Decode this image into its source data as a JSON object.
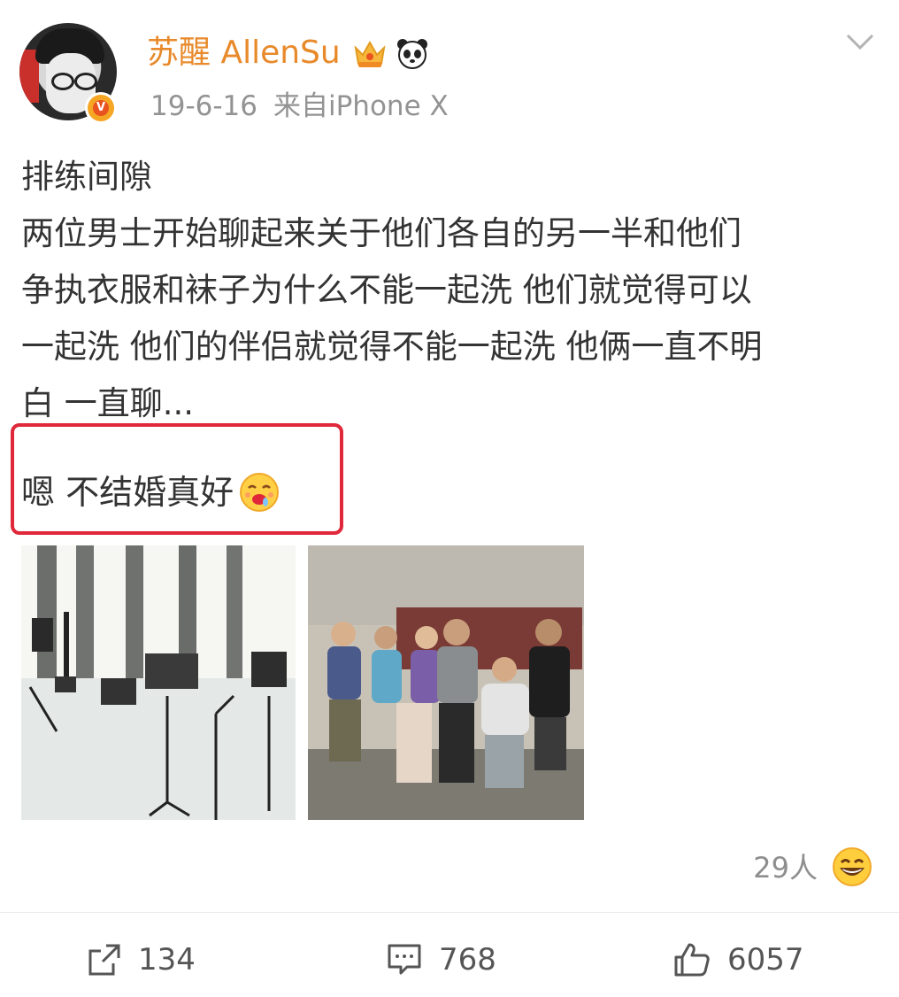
{
  "post": {
    "author": {
      "name": "苏醒 AllenSu",
      "badges": [
        "crown-icon",
        "panda-icon"
      ],
      "verified": true
    },
    "date": "19-6-16",
    "source": "来自iPhone X",
    "lines": [
      "排练间隙",
      "两位男士开始聊起来关于他们各自的另一半和他们",
      "争执衣服和袜子为什么不能一起洗 他们就觉得可以",
      "一起洗 他们的伴侣就觉得不能一起洗 他俩一直不明",
      "白 一直聊..."
    ],
    "highlighted_line": "嗯 不结婚真好",
    "highlight_color": "#e0283a",
    "photos": [
      "rehearsal-room-photo",
      "group-photo"
    ],
    "reactions": {
      "count_label": "29人",
      "emoji": "grinning-face-icon"
    },
    "actions": {
      "share_count": "134",
      "comment_count": "768",
      "like_count": "6057"
    }
  },
  "colors": {
    "username": "#e8892a",
    "meta": "#939393",
    "text": "#333333",
    "verified": "#f5a623"
  }
}
